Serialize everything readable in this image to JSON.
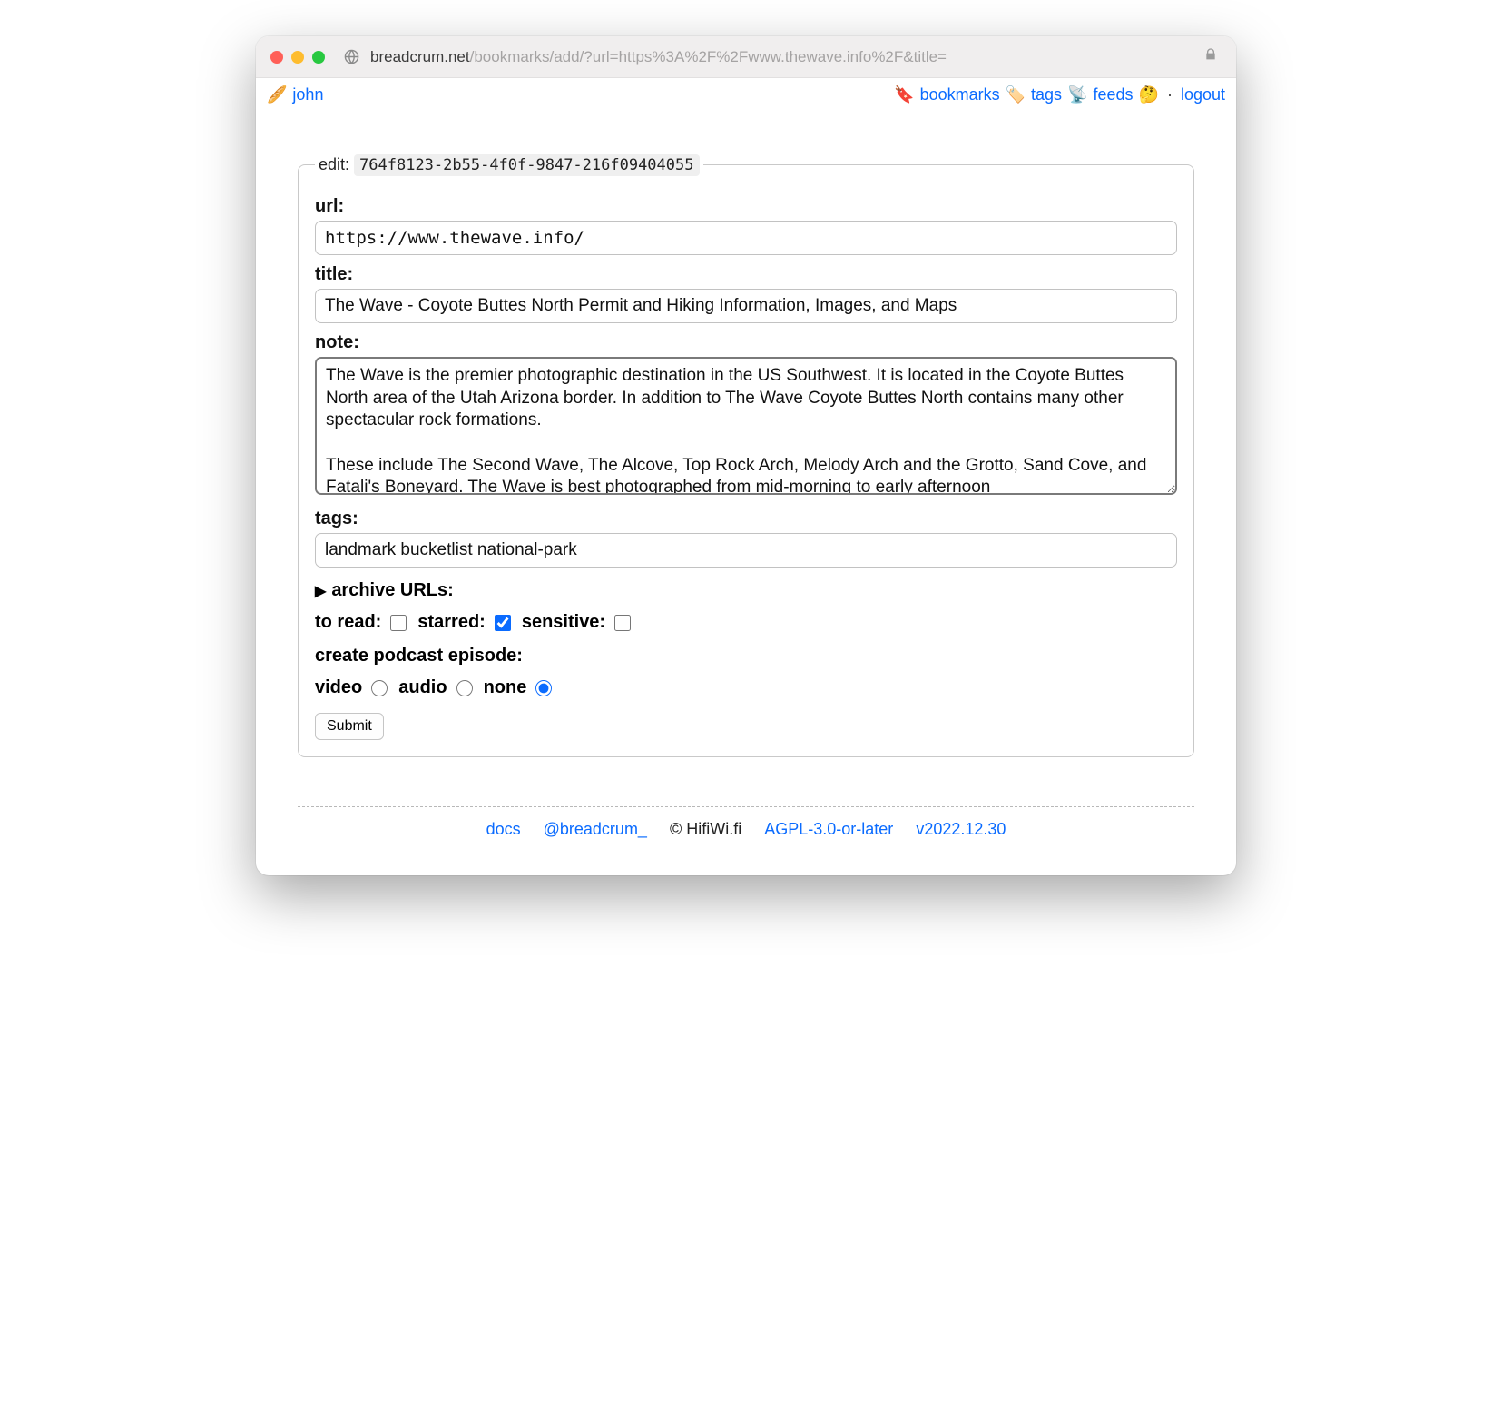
{
  "browser": {
    "url_host": "breadcrum.net",
    "url_rest": "/bookmarks/add/?url=https%3A%2F%2Fwww.thewave.info%2F&title="
  },
  "topnav": {
    "left": {
      "icon": "🥖",
      "user": "john"
    },
    "right": {
      "bookmarks_icon": "🔖",
      "bookmarks": "bookmarks",
      "tags_icon": "🏷️",
      "tags": "tags",
      "feeds_icon": "📡",
      "feeds": "feeds",
      "logout_icon": "🤔",
      "logout": "logout"
    }
  },
  "form": {
    "legend_prefix": "edit: ",
    "uuid": "764f8123-2b55-4f0f-9847-216f09404055",
    "url_label": "url:",
    "url_value": "https://www.thewave.info/",
    "title_label": "title:",
    "title_value": "The Wave - Coyote Buttes North Permit and Hiking Information, Images, and Maps",
    "note_label": "note:",
    "note_value": "The Wave is the premier photographic destination in the US Southwest. It is located in the Coyote Buttes North area of the Utah Arizona border. In addition to The Wave Coyote Buttes North contains many other spectacular rock formations.\n\nThese include The Second Wave, The Alcove, Top Rock Arch, Melody Arch and the Grotto, Sand Cove, and Fatali's Boneyard. The Wave is best photographed from mid-morning to early afternoon",
    "tags_label": "tags:",
    "tags_value": "landmark bucketlist national-park",
    "archive_label": "archive URLs:",
    "toread_label": "to read:",
    "toread_checked": false,
    "starred_label": "starred:",
    "starred_checked": true,
    "sensitive_label": "sensitive:",
    "sensitive_checked": false,
    "podcast_label": "create podcast episode:",
    "podcast_options": {
      "video": "video",
      "audio": "audio",
      "none": "none"
    },
    "podcast_selected": "none",
    "submit": "Submit"
  },
  "footer": {
    "docs": "docs",
    "handle": "@breadcrum_",
    "copyright": "© HifiWi.fi",
    "license": "AGPL-3.0-or-later",
    "version": "v2022.12.30"
  }
}
